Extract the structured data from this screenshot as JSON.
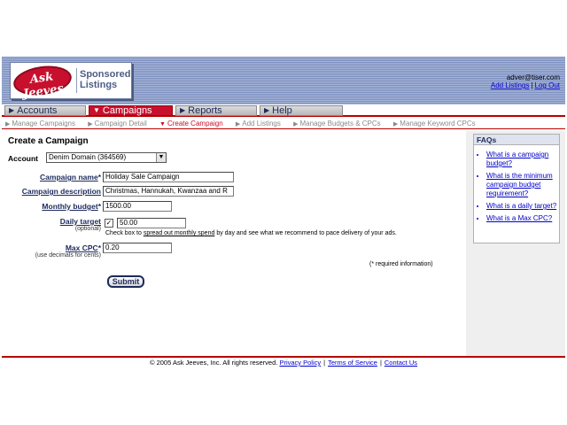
{
  "header": {
    "logo_text": "Ask Jeeves",
    "logo_sub_line1": "Sponsored",
    "logo_sub_line2": "Listings",
    "account_email": "adver@tiser.com",
    "add_listings_link": "Add Listings",
    "logout_link": "Log Out",
    "link_separator": "|"
  },
  "tabs": [
    {
      "label": "Accounts",
      "active": false
    },
    {
      "label": "Campaigns",
      "active": true
    },
    {
      "label": "Reports",
      "active": false
    },
    {
      "label": "Help",
      "active": false
    }
  ],
  "subnav": [
    {
      "label": "Manage Campaigns",
      "current": false
    },
    {
      "label": "Campaign Detail",
      "current": false
    },
    {
      "label": "Create Campaign",
      "current": true
    },
    {
      "label": "Add Listings",
      "current": false
    },
    {
      "label": "Manage Budgets & CPCs",
      "current": false
    },
    {
      "label": "Manage Keyword CPCs",
      "current": false
    }
  ],
  "form": {
    "title": "Create a Campaign",
    "account_label": "Account",
    "account_value": "Denim Domain (364569)",
    "campaign_name_label": "Campaign name",
    "campaign_name_value": "Holiday Sale Campaign",
    "campaign_description_label": "Campaign description",
    "campaign_description_value": "Christmas, Hannukah, Kwanzaa and R",
    "monthly_budget_label": "Monthly budget",
    "monthly_budget_value": "1500.00",
    "daily_target_label": "Daily target",
    "daily_target_optional": "(optional)",
    "daily_target_checked": true,
    "daily_target_value": "50.00",
    "daily_help_prefix": "Check box to ",
    "daily_help_link": "spread out monthly spend",
    "daily_help_suffix": " by day and see what we recommend to pace delivery of your ads.",
    "max_cpc_label": "Max CPC",
    "max_cpc_hint": "(use decimals for cents)",
    "max_cpc_value": "0.20",
    "required_marker": "*",
    "required_note": "(* required information)",
    "submit_label": "Submit"
  },
  "faq": {
    "title": "FAQs",
    "items": [
      "What is a campaign budget?",
      "What is the minimum campaign budget requirement?",
      "What is a daily target?",
      "What is a Max CPC?"
    ]
  },
  "footer": {
    "copyright": "© 2005 Ask Jeeves, Inc. All rights reserved.",
    "privacy": "Privacy Policy",
    "terms": "Terms of Service",
    "contact": "Contact Us",
    "separator": "|"
  },
  "colors": {
    "brand_red": "#c8102e",
    "nav_blue": "#1c2a5c",
    "link_blue": "#0000cc"
  }
}
